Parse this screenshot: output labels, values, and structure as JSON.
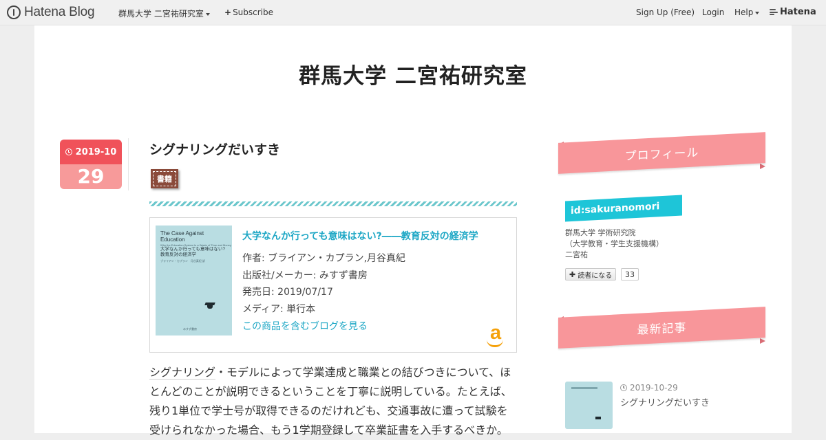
{
  "header": {
    "brand": "Hatena Blog",
    "blog_menu": "群馬大学 二宮祐研究室",
    "subscribe": "Subscribe",
    "signup": "Sign Up (Free)",
    "login": "Login",
    "help": "Help",
    "hatena": "Hatena"
  },
  "blog": {
    "title": "群馬大学 二宮祐研究室"
  },
  "entry": {
    "date_month": "2019-10",
    "date_day": "29",
    "title": "シグナリングだいすき",
    "category": "書籍",
    "colors": {
      "date_top": "#f0525a",
      "date_bottom": "#f79a9a",
      "accent": "#1ea7c5",
      "category": "#8a4a3a"
    }
  },
  "amazon": {
    "title": "大学なんか行っても意味はない?――教育反対の経済学",
    "author": "作者: ブライアン・カプラン,月谷真紀",
    "publisher": "出版社/メーカー: みすず書房",
    "release": "発売日: 2019/07/17",
    "media": "メディア: 単行本",
    "link": "この商品を含むブログを見る",
    "cover": {
      "en_title": "The Case Against Education",
      "en_sub": "Why the Education System Is a Waste of Time and Money",
      "jp_title": "大学なんか行っても意味はない?",
      "jp_sub": "教育反対の経済学",
      "authors": "ブライアン・カプラン　月谷真紀 訳",
      "publisher": "みすず書房"
    }
  },
  "body": {
    "keyword": "シグナリング",
    "line1_rest": "・モデルによって学業達成と職業との結びつきについて、ほ",
    "line2": "とんどのことが説明できるということを丁寧に説明している。たとえば、",
    "line3": "残り1単位で学士号が取得できるのだけれども、交通事故に遭って試験を",
    "line4": "受けられなかった場合、もう1学期登録して卒業証書を入手するべきか。"
  },
  "sidebar": {
    "profile_heading": "プロフィール",
    "profile_id": "id:sakuranomori",
    "profile_line1": "群馬大学 学術研究院",
    "profile_line2": "（大学教育・学生支援機構）",
    "profile_line3": "二宮祐",
    "reader_button": "読者になる",
    "reader_count": "33",
    "latest_heading": "最新記事",
    "recent_date": "2019-10-29",
    "recent_title": "シグナリングだいすき",
    "colors": {
      "ribbon": "#f8969a",
      "id_badge": "#1ec5d8"
    }
  }
}
